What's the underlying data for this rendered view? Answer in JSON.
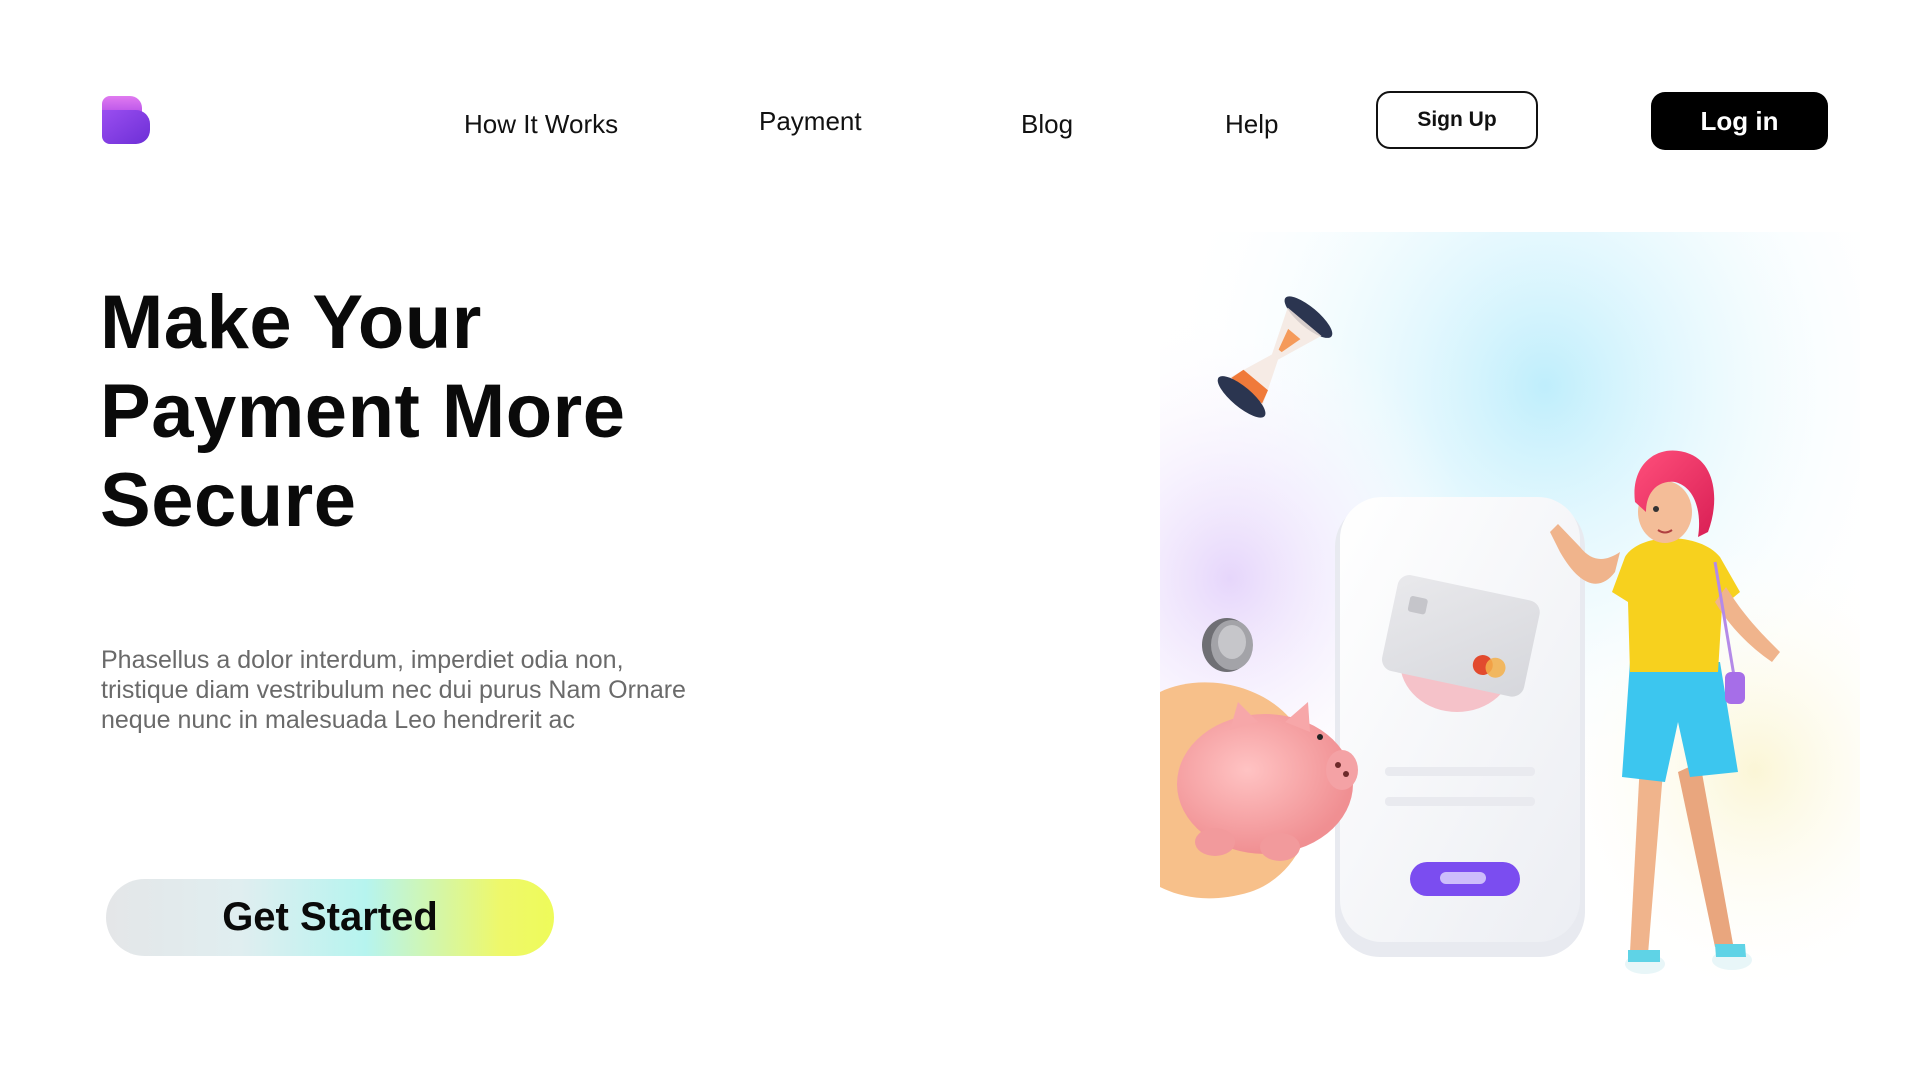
{
  "header": {
    "logo_icon": "brand-logo-icon",
    "nav": [
      {
        "label": "How It Works"
      },
      {
        "label": "Payment"
      },
      {
        "label": "Blog"
      },
      {
        "label": "Help"
      }
    ],
    "signup_label": "Sign Up",
    "login_label": "Log in"
  },
  "hero": {
    "title_lines": [
      "Make Your",
      "Payment More",
      "Secure"
    ],
    "description_lines": [
      "Phasellus a dolor interdum, imperdiet odia non,",
      "tristique diam vestribulum nec dui purus Nam Ornare",
      "neque nunc in malesuada Leo hendrerit ac"
    ],
    "cta_label": "Get Started"
  },
  "illustration": {
    "elements": [
      "hourglass-icon",
      "coin-icon",
      "piggy-bank-icon",
      "phone-with-card-icon",
      "woman-character"
    ]
  },
  "colors": {
    "brand_purple": "#8b3ee0",
    "logo_pink": "#d56be8",
    "text_dark": "#0a0a0a",
    "text_muted": "#6a6a6a",
    "cta_gradient_start": "#e4e6e8",
    "cta_gradient_mid": "#b6f4ef",
    "cta_gradient_end": "#eefb5a",
    "login_bg": "#000000"
  }
}
